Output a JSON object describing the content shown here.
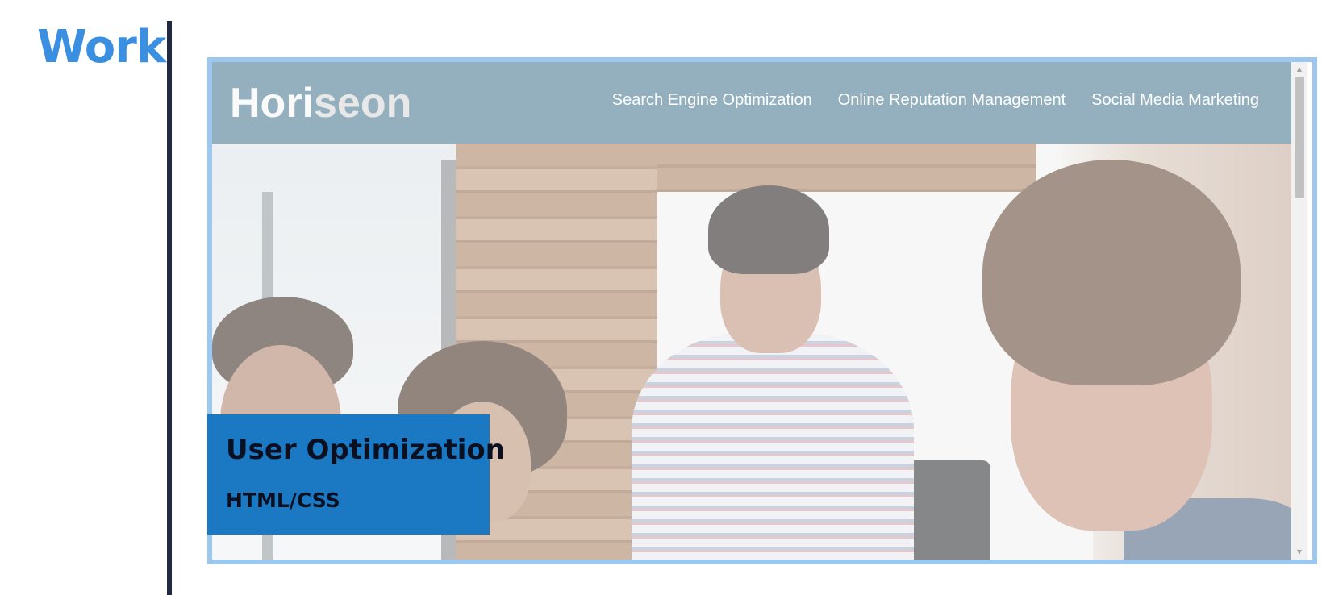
{
  "section": {
    "title": "Work"
  },
  "project": {
    "preview": {
      "logo_prefix": "Hori",
      "logo_suffix": "seon",
      "nav_items": [
        "Search Engine Optimization",
        "Online Reputation Management",
        "Social Media Marketing"
      ]
    },
    "caption": {
      "title": "User Optimization",
      "tech": "HTML/CSS"
    }
  },
  "colors": {
    "accent": "#3a8fe0",
    "divider": "#1f2a44",
    "card_border": "#9cc8ef",
    "caption_bg": "#1b78c2",
    "preview_header": "#94b0bf"
  },
  "icons": {
    "scroll_up": "scroll-up-arrow-icon",
    "scroll_down": "scroll-down-arrow-icon"
  }
}
